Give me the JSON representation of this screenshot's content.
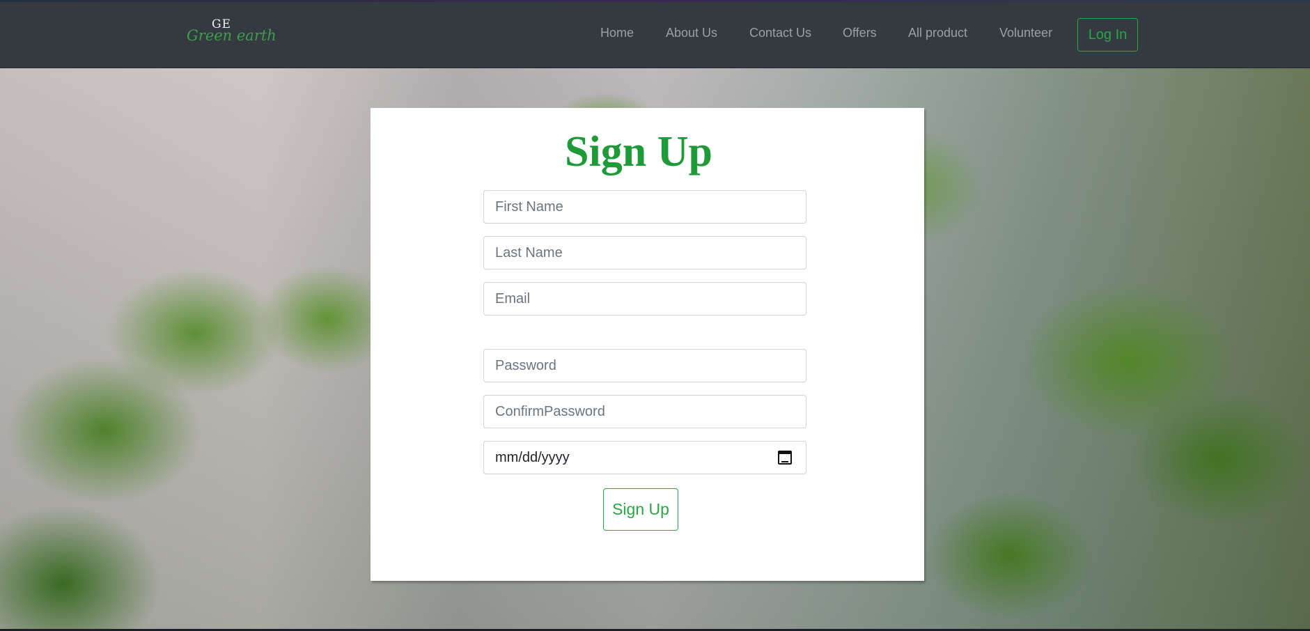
{
  "brand": {
    "initials": "GE",
    "name": "Green earth"
  },
  "nav": {
    "links": [
      "Home",
      "About Us",
      "Contact Us",
      "Offers",
      "All product",
      "Volunteer"
    ],
    "login_label": "Log In"
  },
  "form": {
    "title": "Sign Up",
    "first_name_placeholder": "First Name",
    "last_name_placeholder": "Last Name",
    "email_placeholder": "Email",
    "password_placeholder": "Password",
    "confirm_password_placeholder": "ConfirmPassword",
    "date_placeholder": "mm/dd/yyyy",
    "submit_label": "Sign Up"
  },
  "colors": {
    "accent": "#28a745",
    "title": "#1f9a38",
    "navbar": "#343a40"
  },
  "icons": {
    "date_picker": "calendar-icon"
  }
}
